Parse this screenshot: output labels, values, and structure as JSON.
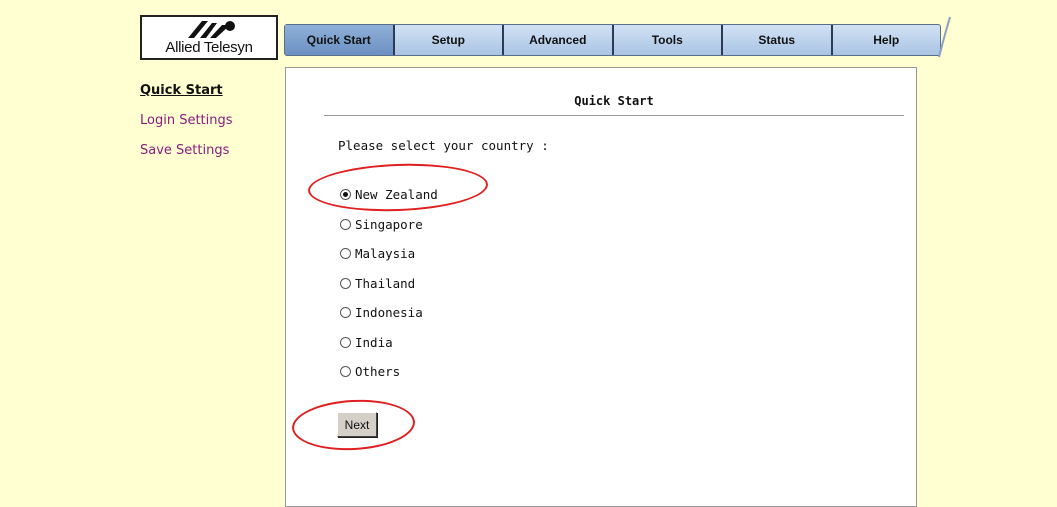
{
  "logo": {
    "brand": "Allied Telesyn"
  },
  "nav": {
    "items": [
      "Quick Start",
      "Setup",
      "Advanced",
      "Tools",
      "Status",
      "Help"
    ],
    "active": "Quick Start"
  },
  "sidebar": {
    "items": [
      "Quick Start",
      "Login Settings",
      "Save Settings"
    ],
    "active": "Quick Start"
  },
  "main": {
    "title": "Quick Start",
    "prompt": "Please select your country :",
    "options": [
      "New Zealand",
      "Singapore",
      "Malaysia",
      "Thailand",
      "Indonesia",
      "India",
      "Others"
    ],
    "selected": "New Zealand",
    "next_label": "Next"
  },
  "colors": {
    "page_background": "#ffffd2",
    "nav_active": "#7a9dcc",
    "sidebar_link": "#8b1c7b",
    "annotation": "#e02020"
  }
}
